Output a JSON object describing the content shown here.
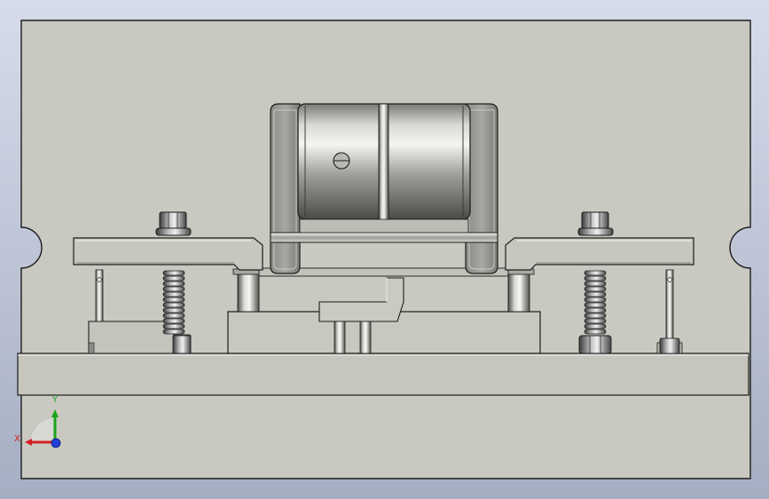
{
  "viewport": {
    "background_top": "#d7dceb",
    "background_bottom": "#a5aec2",
    "part_fill": "#c9c9c1",
    "part_stroke": "#1c1c1c",
    "metal_light": "#f2f2f0",
    "metal_dark": "#5d5d5d"
  },
  "triad": {
    "x_label": "X",
    "y_label": "Y",
    "x_color": "#d42020",
    "y_color": "#1aa31a",
    "z_color": "#1f3fd6"
  }
}
